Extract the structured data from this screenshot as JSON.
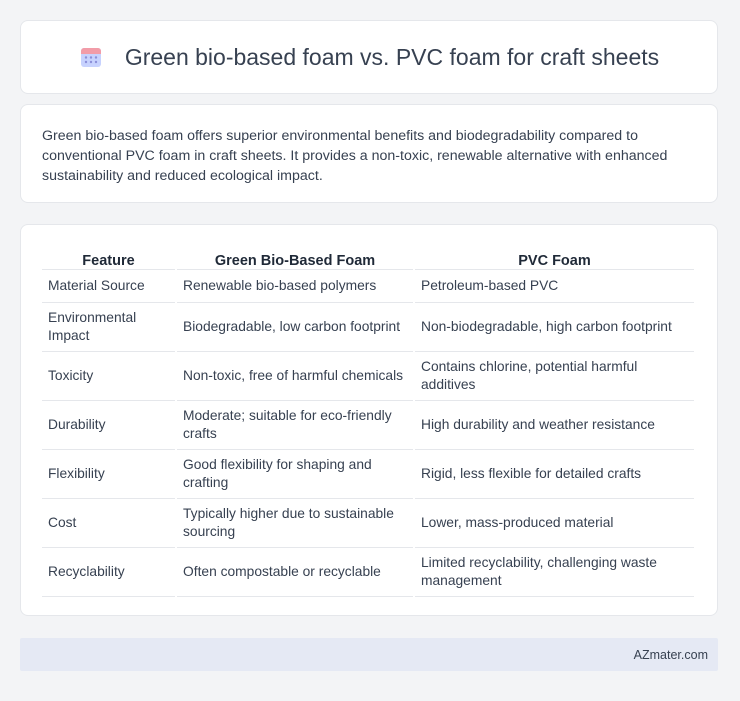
{
  "header": {
    "title": "Green bio-based foam vs. PVC foam for craft sheets",
    "icon": "calendar-grid-icon"
  },
  "summary": {
    "text": "Green bio-based foam offers superior environmental benefits and biodegradability compared to conventional PVC foam in craft sheets. It provides a non-toxic, renewable alternative with enhanced sustainability and reduced ecological impact."
  },
  "table": {
    "headers": [
      "Feature",
      "Green Bio-Based Foam",
      "PVC Foam"
    ],
    "rows": [
      [
        "Material Source",
        "Renewable bio-based polymers",
        "Petroleum-based PVC"
      ],
      [
        "Environmental Impact",
        "Biodegradable, low carbon footprint",
        "Non-biodegradable, high carbon footprint"
      ],
      [
        "Toxicity",
        "Non-toxic, free of harmful chemicals",
        "Contains chlorine, potential harmful additives"
      ],
      [
        "Durability",
        "Moderate; suitable for eco-friendly crafts",
        "High durability and weather resistance"
      ],
      [
        "Flexibility",
        "Good flexibility for shaping and crafting",
        "Rigid, less flexible for detailed crafts"
      ],
      [
        "Cost",
        "Typically higher due to sustainable sourcing",
        "Lower, mass-produced material"
      ],
      [
        "Recyclability",
        "Often compostable or recyclable",
        "Limited recyclability, challenging waste management"
      ]
    ]
  },
  "footer": {
    "brand": "AZmater.com"
  },
  "colors": {
    "icon_top": "#f29ca8",
    "icon_body": "#c7d2fe",
    "icon_dots": "#8b8fd9",
    "footer_bg": "#e5e9f4"
  }
}
